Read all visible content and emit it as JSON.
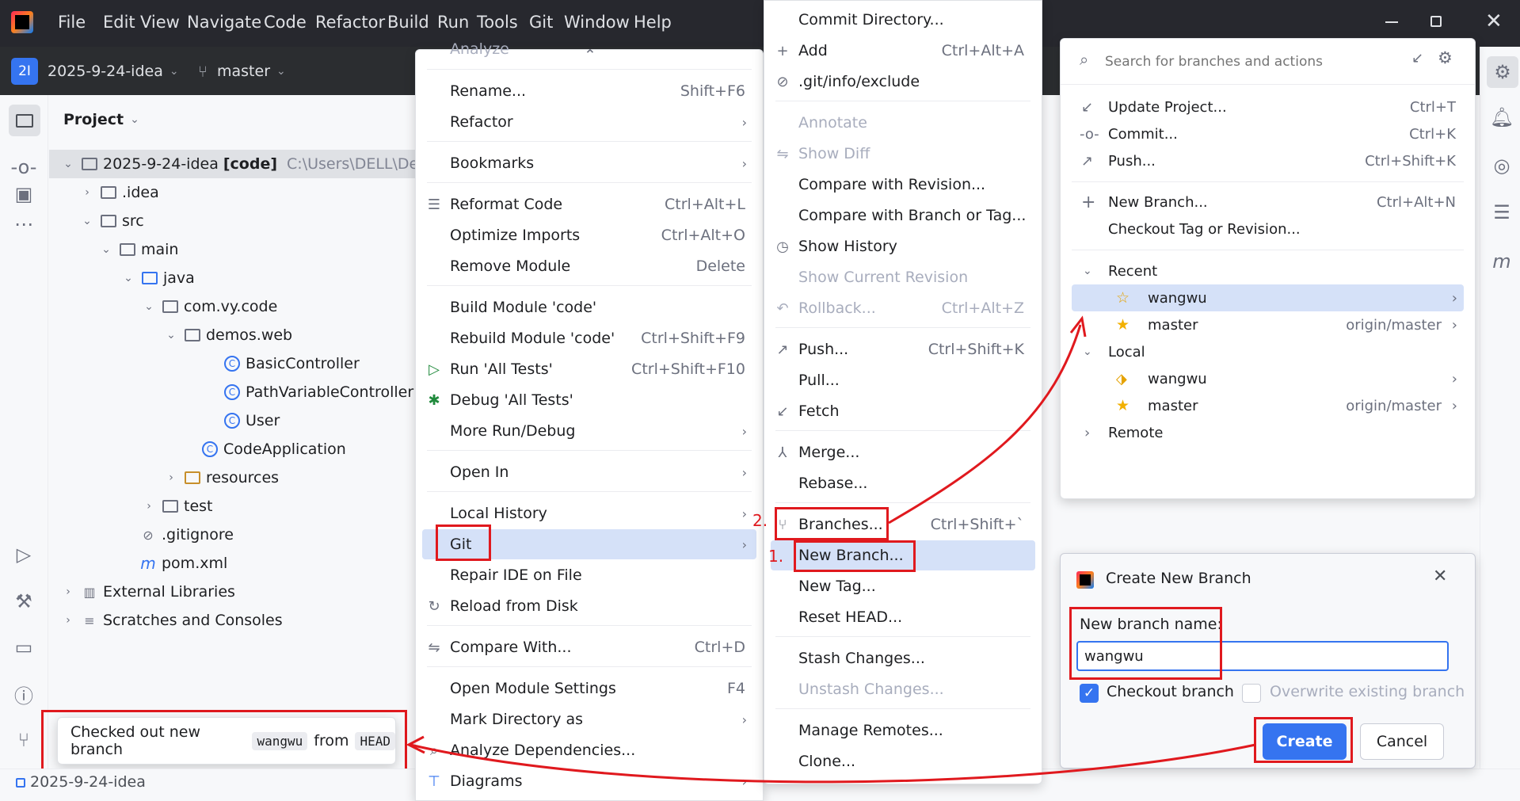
{
  "titlebar": {
    "menus": [
      "File",
      "Edit",
      "View",
      "Navigate",
      "Code",
      "Refactor",
      "Build",
      "Run",
      "Tools",
      "Git",
      "Window",
      "Help"
    ],
    "minimize_icon": "minimize-icon",
    "maximize_icon": "restore-icon",
    "close_icon": "close-icon"
  },
  "toolbar": {
    "project_badge": "2I",
    "project_name": "2025-9-24-idea",
    "branch": "master"
  },
  "project_panel": {
    "title": "Project",
    "tree": [
      {
        "label": "2025-9-24-idea",
        "suffix": "[code]",
        "path": "C:\\Users\\DELL\\Deskto"
      },
      {
        "label": ".idea"
      },
      {
        "label": "src"
      },
      {
        "label": "main"
      },
      {
        "label": "java"
      },
      {
        "label": "com.vy.code"
      },
      {
        "label": "demos.web"
      },
      {
        "label": "BasicController"
      },
      {
        "label": "PathVariableController"
      },
      {
        "label": "User"
      },
      {
        "label": "CodeApplication"
      },
      {
        "label": "resources"
      },
      {
        "label": "test"
      },
      {
        "label": ".gitignore"
      },
      {
        "label": "pom.xml"
      },
      {
        "label": "External Libraries"
      },
      {
        "label": "Scratches and Consoles"
      }
    ]
  },
  "context_menu": {
    "items": [
      {
        "label": "Analyze"
      },
      {
        "label": "Rename...",
        "shortcut": "Shift+F6"
      },
      {
        "label": "Refactor"
      },
      {
        "label": "Bookmarks"
      },
      {
        "label": "Reformat Code",
        "shortcut": "Ctrl+Alt+L"
      },
      {
        "label": "Optimize Imports",
        "shortcut": "Ctrl+Alt+O"
      },
      {
        "label": "Remove Module",
        "shortcut": "Delete"
      },
      {
        "label": "Build Module 'code'"
      },
      {
        "label": "Rebuild Module 'code'",
        "shortcut": "Ctrl+Shift+F9"
      },
      {
        "label": "Run 'All Tests'",
        "shortcut": "Ctrl+Shift+F10"
      },
      {
        "label": "Debug 'All Tests'"
      },
      {
        "label": "More Run/Debug"
      },
      {
        "label": "Open In"
      },
      {
        "label": "Local History"
      },
      {
        "label": "Git"
      },
      {
        "label": "Repair IDE on File"
      },
      {
        "label": "Reload from Disk"
      },
      {
        "label": "Compare With...",
        "shortcut": "Ctrl+D"
      },
      {
        "label": "Open Module Settings",
        "shortcut": "F4"
      },
      {
        "label": "Mark Directory as"
      },
      {
        "label": "Analyze Dependencies..."
      },
      {
        "label": "Diagrams"
      }
    ]
  },
  "git_menu": {
    "items": [
      {
        "label": "Commit Directory..."
      },
      {
        "label": "Add",
        "shortcut": "Ctrl+Alt+A"
      },
      {
        "label": ".git/info/exclude"
      },
      {
        "label": "Annotate"
      },
      {
        "label": "Show Diff"
      },
      {
        "label": "Compare with Revision..."
      },
      {
        "label": "Compare with Branch or Tag..."
      },
      {
        "label": "Show History"
      },
      {
        "label": "Show Current Revision"
      },
      {
        "label": "Rollback...",
        "shortcut": "Ctrl+Alt+Z"
      },
      {
        "label": "Push...",
        "shortcut": "Ctrl+Shift+K"
      },
      {
        "label": "Pull..."
      },
      {
        "label": "Fetch"
      },
      {
        "label": "Merge..."
      },
      {
        "label": "Rebase..."
      },
      {
        "label": "Branches...",
        "shortcut": "Ctrl+Shift+`"
      },
      {
        "label": "New Branch..."
      },
      {
        "label": "New Tag..."
      },
      {
        "label": "Reset HEAD..."
      },
      {
        "label": "Stash Changes..."
      },
      {
        "label": "Unstash Changes..."
      },
      {
        "label": "Manage Remotes..."
      },
      {
        "label": "Clone..."
      }
    ],
    "step1": "1.",
    "step2": "2."
  },
  "branches_popup": {
    "search_placeholder": "Search for branches and actions",
    "actions": [
      {
        "label": "Update Project...",
        "shortcut": "Ctrl+T"
      },
      {
        "label": "Commit...",
        "shortcut": "Ctrl+K"
      },
      {
        "label": "Push...",
        "shortcut": "Ctrl+Shift+K"
      },
      {
        "label": "New Branch...",
        "shortcut": "Ctrl+Alt+N"
      },
      {
        "label": "Checkout Tag or Revision..."
      }
    ],
    "recent_header": "Recent",
    "recent": [
      {
        "name": "wangwu"
      },
      {
        "name": "master",
        "remote": "origin/master"
      }
    ],
    "local_header": "Local",
    "local": [
      {
        "name": "wangwu"
      },
      {
        "name": "master",
        "remote": "origin/master"
      }
    ],
    "remote_header": "Remote"
  },
  "dialog": {
    "title": "Create New Branch",
    "name_label": "New branch name:",
    "name_value": "wangwu",
    "checkout_label": "Checkout branch",
    "checkout_checked": true,
    "overwrite_label": "Overwrite existing branch",
    "create_label": "Create",
    "cancel_label": "Cancel"
  },
  "notification": {
    "prefix": "Checked out new branch",
    "branch": "wangwu",
    "middle": "from",
    "ref": "HEAD"
  },
  "statusbar": {
    "project": "2025-9-24-idea"
  },
  "colors": {
    "accent": "#3574f0",
    "annotation_red": "#e0191e",
    "selection": "#d5e1f8",
    "dark_header": "#2b2d30"
  }
}
